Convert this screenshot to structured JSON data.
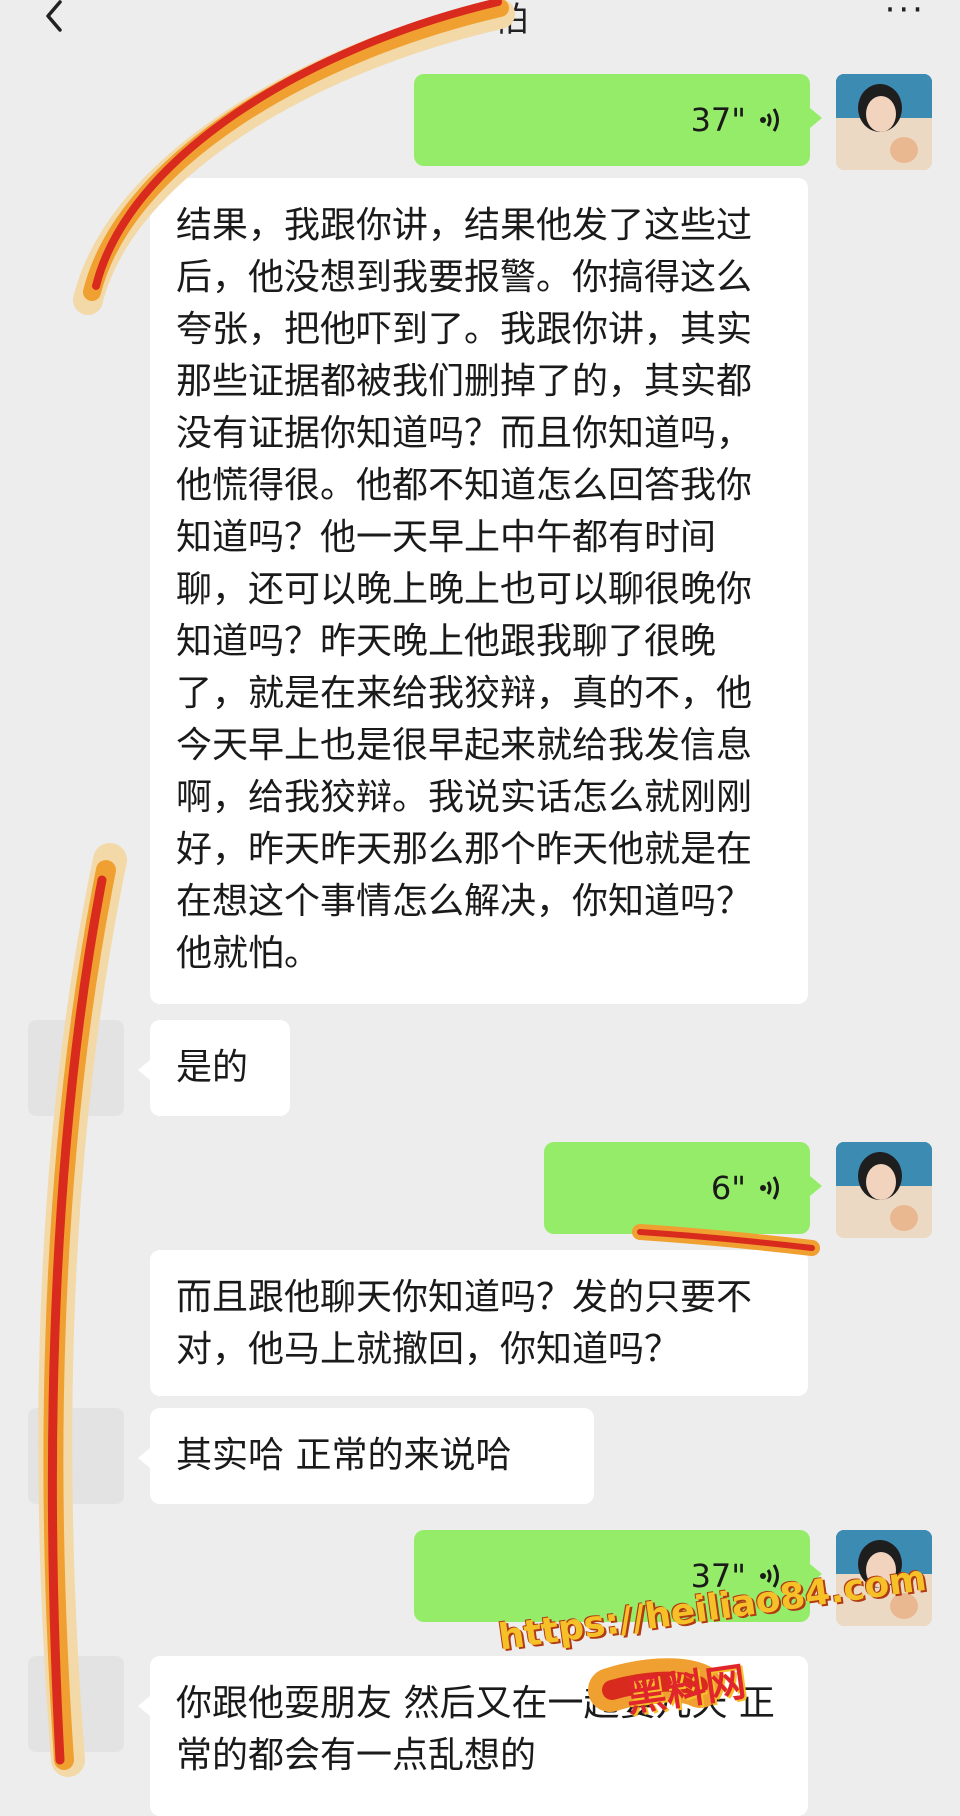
{
  "header": {
    "title": "怕",
    "back_icon": "chevron-left-icon",
    "more_icon": "more-dots-icon",
    "more_text": "···"
  },
  "messages": [
    {
      "side": "right",
      "type": "voice",
      "duration": "37\""
    },
    {
      "side": "left",
      "type": "text",
      "text": "结果，我跟你讲，结果他发了这些过后，他没想到我要报警。你搞得这么夸张，把他吓到了。我跟你讲，其实那些证据都被我们删掉了的，其实都没有证据你知道吗？而且你知道吗，他慌得很。他都不知道怎么回答我你知道吗？他一天早上中午都有时间聊，还可以晚上晚上也可以聊很晚你知道吗？昨天晚上他跟我聊了很晚了，就是在来给我狡辩，真的不，他今天早上也是很早起来就给我发信息啊，给我狡辩。我说实话怎么就刚刚好，昨天昨天那么那个昨天他就是在在想这个事情怎么解决，你知道吗？他就怕。"
    },
    {
      "side": "left",
      "type": "text",
      "text": "是的"
    },
    {
      "side": "right",
      "type": "voice",
      "duration": "6\""
    },
    {
      "side": "left",
      "type": "text",
      "text": "而且跟他聊天你知道吗？发的只要不对，他马上就撤回，你知道吗？"
    },
    {
      "side": "left",
      "type": "text",
      "text": "其实哈  正常的来说哈"
    },
    {
      "side": "right",
      "type": "voice",
      "duration": "37\""
    },
    {
      "side": "left",
      "type": "text",
      "text": "你跟他耍朋友  然后又在一起耍几天  正常的都会有一点乱想的"
    }
  ],
  "watermark": {
    "url": "https://heiliao84.com",
    "brand": "黑料网"
  },
  "colors": {
    "background": "#ededed",
    "outgoing_bubble": "#95ec69",
    "incoming_bubble": "#ffffff"
  }
}
